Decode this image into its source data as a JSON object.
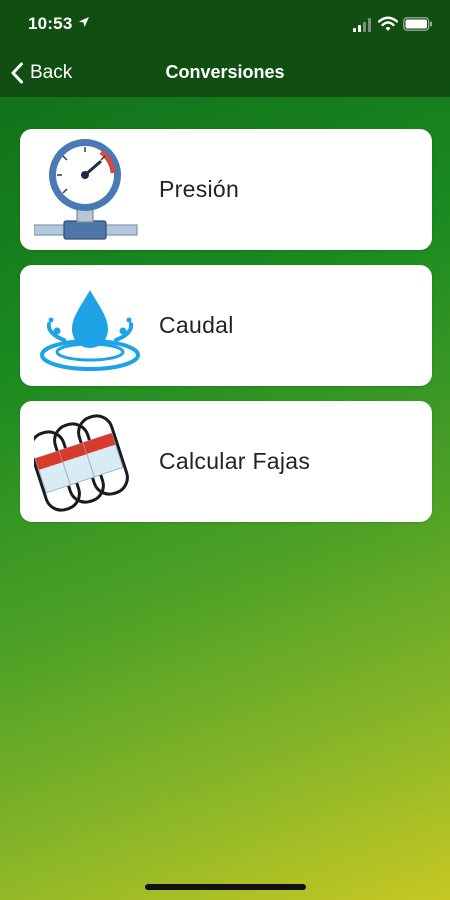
{
  "status_bar": {
    "time": "10:53",
    "icons": [
      "location-arrow-icon",
      "cellular-signal-icon",
      "wifi-icon",
      "battery-icon"
    ]
  },
  "nav": {
    "back_label": "Back",
    "title": "Conversiones"
  },
  "menu": {
    "items": [
      {
        "label": "Presión",
        "icon": "pressure-gauge-icon"
      },
      {
        "label": "Caudal",
        "icon": "water-drop-icon"
      },
      {
        "label": "Calcular Fajas",
        "icon": "belts-icon"
      }
    ]
  },
  "colors": {
    "header": "#104e12",
    "gradient_start": "#0f6a18",
    "gradient_end": "#c6c823",
    "card": "#ffffff"
  }
}
